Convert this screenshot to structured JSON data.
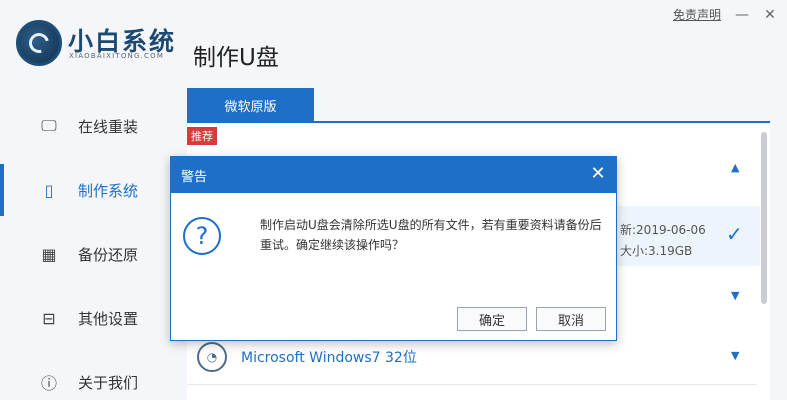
{
  "app": {
    "brand": "小白系统",
    "brand_sub": "XIAOBAIXITONG.COM",
    "page_title": "制作U盘",
    "disclaimer": "免责声明",
    "minimize_glyph": "—",
    "close_glyph": "✕"
  },
  "sidebar": {
    "items": [
      {
        "label": "在线重装",
        "icon": "monitor-icon",
        "glyph": "🖵"
      },
      {
        "label": "制作系统",
        "icon": "usb-icon",
        "glyph": "▯"
      },
      {
        "label": "备份还原",
        "icon": "grid-icon",
        "glyph": "▦"
      },
      {
        "label": "其他设置",
        "icon": "briefcase-icon",
        "glyph": "⊟"
      },
      {
        "label": "关于我们",
        "icon": "info-icon",
        "glyph": "ⓘ"
      }
    ],
    "active_index": 1
  },
  "tabs": [
    {
      "label": "微软原版"
    }
  ],
  "badge": "推荐",
  "list": {
    "selected_date": "新:2019-06-06",
    "selected_size": "大小:3.19GB",
    "win7_label": "Microsoft Windows7 32位",
    "arrow_up": "▲",
    "arrow_down": "▼",
    "check_glyph": "✓"
  },
  "dialog": {
    "title": "警告",
    "close_glyph": "✕",
    "question_glyph": "?",
    "message": "制作启动U盘会清除所选U盘的所有文件，若有重要资料请备份后重试。确定继续该操作吗？",
    "ok_label": "确定",
    "cancel_label": "取消"
  },
  "colors": {
    "accent": "#1e6fc7",
    "badge": "#d93b3b",
    "brand": "#1c4a73"
  }
}
